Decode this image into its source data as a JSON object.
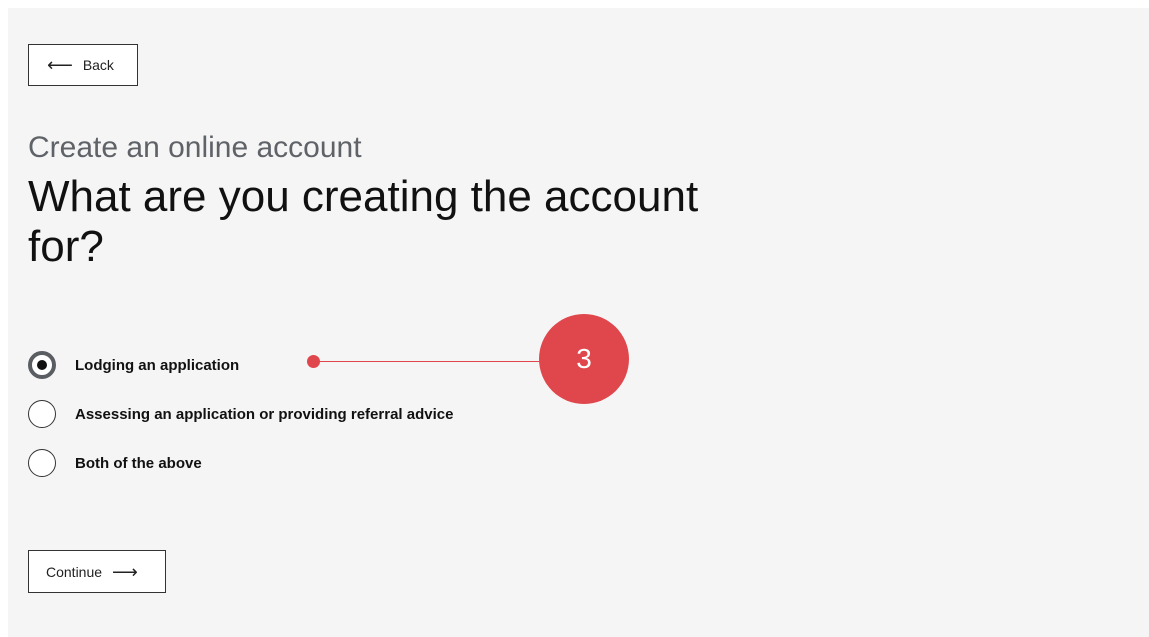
{
  "back_button": {
    "label": "Back",
    "icon": "arrow-left-icon"
  },
  "header": {
    "kicker": "Create an online account",
    "question": "What are you creating the account for?"
  },
  "options": [
    {
      "label": "Lodging an application",
      "selected": true
    },
    {
      "label": "Assessing an application or providing referral advice",
      "selected": false
    },
    {
      "label": "Both of the above",
      "selected": false
    }
  ],
  "annotation": {
    "number": "3",
    "color": "#e0474c"
  },
  "continue_button": {
    "label": "Continue",
    "icon": "arrow-right-icon"
  }
}
